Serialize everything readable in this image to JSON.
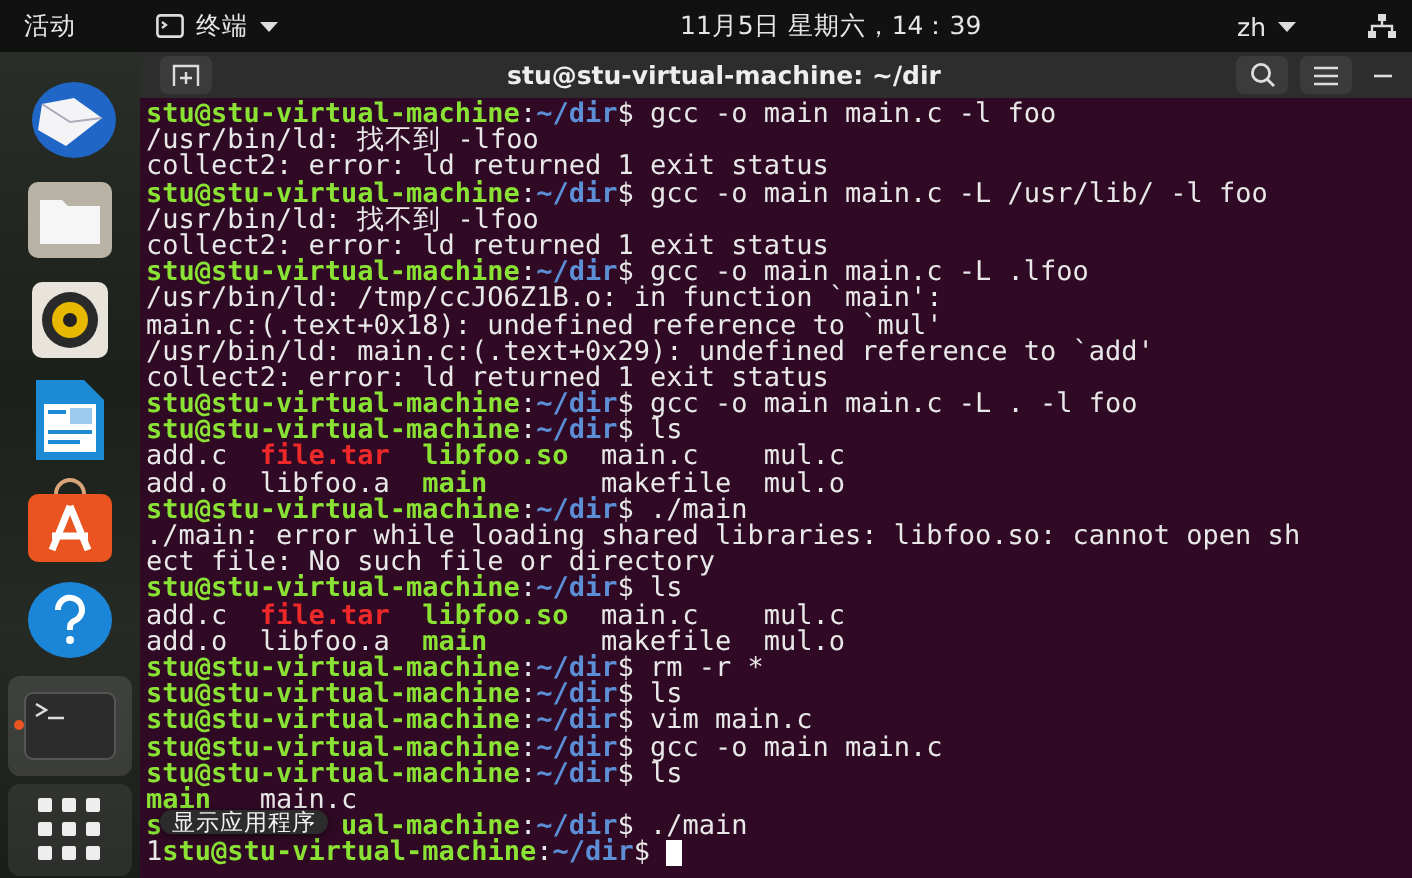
{
  "top_bar": {
    "activities": "活动",
    "app_menu": "终端",
    "clock": "11月5日 星期六，14：39",
    "input_method": "zh"
  },
  "dock": {
    "apps": [
      {
        "kind": "mail",
        "running": false
      },
      {
        "kind": "files",
        "running": false
      },
      {
        "kind": "music",
        "running": false
      },
      {
        "kind": "writer",
        "running": false
      },
      {
        "kind": "store",
        "running": false
      },
      {
        "kind": "help",
        "running": false
      },
      {
        "kind": "terminal",
        "running": true
      }
    ],
    "tooltip": "显示应用程序"
  },
  "window": {
    "title": "stu@stu-virtual-machine: ~/dir"
  },
  "terminal": {
    "lines": [
      {
        "kind": "prompt",
        "user": "stu@stu-virtual-machine",
        "separator": ":",
        "path": "~/dir",
        "sign": "$",
        "command": "gcc -o main main.c -l foo"
      },
      {
        "kind": "output",
        "text": "/usr/bin/ld: 找不到 -lfoo"
      },
      {
        "kind": "output",
        "text": "collect2: error: ld returned 1 exit status"
      },
      {
        "kind": "prompt",
        "user": "stu@stu-virtual-machine",
        "separator": ":",
        "path": "~/dir",
        "sign": "$",
        "command": "gcc -o main main.c -L /usr/lib/ -l foo"
      },
      {
        "kind": "output",
        "text": "/usr/bin/ld: 找不到 -lfoo"
      },
      {
        "kind": "output",
        "text": "collect2: error: ld returned 1 exit status"
      },
      {
        "kind": "prompt",
        "user": "stu@stu-virtual-machine",
        "separator": ":",
        "path": "~/dir",
        "sign": "$",
        "command": "gcc -o main main.c -L .lfoo"
      },
      {
        "kind": "output",
        "text": "/usr/bin/ld: /tmp/ccJO6Z1B.o: in function `main':"
      },
      {
        "kind": "output",
        "text": "main.c:(.text+0x18): undefined reference to `mul'"
      },
      {
        "kind": "output",
        "text": "/usr/bin/ld: main.c:(.text+0x29): undefined reference to `add'"
      },
      {
        "kind": "output",
        "text": "collect2: error: ld returned 1 exit status"
      },
      {
        "kind": "prompt",
        "user": "stu@stu-virtual-machine",
        "separator": ":",
        "path": "~/dir",
        "sign": "$",
        "command": "gcc -o main main.c -L . -l foo"
      },
      {
        "kind": "prompt",
        "user": "stu@stu-virtual-machine",
        "separator": ":",
        "path": "~/dir",
        "sign": "$",
        "command": "ls"
      },
      {
        "kind": "files",
        "items": [
          {
            "name": "add.c",
            "kind": "plain"
          },
          {
            "name": "file.tar",
            "kind": "archive"
          },
          {
            "name": "libfoo.so",
            "kind": "executable"
          },
          {
            "name": "main.c",
            "kind": "plain"
          },
          {
            "name": "mul.c",
            "kind": "plain"
          }
        ]
      },
      {
        "kind": "files",
        "items": [
          {
            "name": "add.o",
            "kind": "plain"
          },
          {
            "name": "libfoo.a",
            "kind": "plain"
          },
          {
            "name": "main",
            "kind": "executable"
          },
          {
            "name": "makefile",
            "kind": "plain"
          },
          {
            "name": "mul.o",
            "kind": "plain"
          }
        ]
      },
      {
        "kind": "prompt",
        "user": "stu@stu-virtual-machine",
        "separator": ":",
        "path": "~/dir",
        "sign": "$",
        "command": "./main"
      },
      {
        "kind": "output",
        "text": "./main: error while loading shared libraries: libfoo.so: cannot open sh"
      },
      {
        "kind": "output",
        "text": "ect file: No such file or directory"
      },
      {
        "kind": "prompt",
        "user": "stu@stu-virtual-machine",
        "separator": ":",
        "path": "~/dir",
        "sign": "$",
        "command": "ls"
      },
      {
        "kind": "files",
        "items": [
          {
            "name": "add.c",
            "kind": "plain"
          },
          {
            "name": "file.tar",
            "kind": "archive"
          },
          {
            "name": "libfoo.so",
            "kind": "executable"
          },
          {
            "name": "main.c",
            "kind": "plain"
          },
          {
            "name": "mul.c",
            "kind": "plain"
          }
        ]
      },
      {
        "kind": "files",
        "items": [
          {
            "name": "add.o",
            "kind": "plain"
          },
          {
            "name": "libfoo.a",
            "kind": "plain"
          },
          {
            "name": "main",
            "kind": "executable"
          },
          {
            "name": "makefile",
            "kind": "plain"
          },
          {
            "name": "mul.o",
            "kind": "plain"
          }
        ]
      },
      {
        "kind": "prompt",
        "user": "stu@stu-virtual-machine",
        "separator": ":",
        "path": "~/dir",
        "sign": "$",
        "command": "rm -r *"
      },
      {
        "kind": "prompt",
        "user": "stu@stu-virtual-machine",
        "separator": ":",
        "path": "~/dir",
        "sign": "$",
        "command": "ls"
      },
      {
        "kind": "prompt",
        "user": "stu@stu-virtual-machine",
        "separator": ":",
        "path": "~/dir",
        "sign": "$",
        "command": "vim main.c"
      },
      {
        "kind": "prompt",
        "user": "stu@stu-virtual-machine",
        "separator": ":",
        "path": "~/dir",
        "sign": "$",
        "command": "gcc -o main main.c"
      },
      {
        "kind": "prompt",
        "user": "stu@stu-virtual-machine",
        "separator": ":",
        "path": "~/dir",
        "sign": "$",
        "command": "ls"
      },
      {
        "kind": "files",
        "items": [
          {
            "name": "main",
            "kind": "executable"
          },
          {
            "name": "main.c",
            "kind": "plain"
          }
        ]
      },
      {
        "kind": "prompt",
        "user": "s",
        "user_after_tooltip": "ual-machine",
        "separator": ":",
        "path": "~/dir",
        "sign": "$",
        "command": "./main"
      },
      {
        "kind": "prompt",
        "prefix": "1",
        "user": "stu@stu-virtual-machine",
        "separator": ":",
        "path": "~/dir",
        "sign": "$",
        "cursor": true
      }
    ]
  }
}
